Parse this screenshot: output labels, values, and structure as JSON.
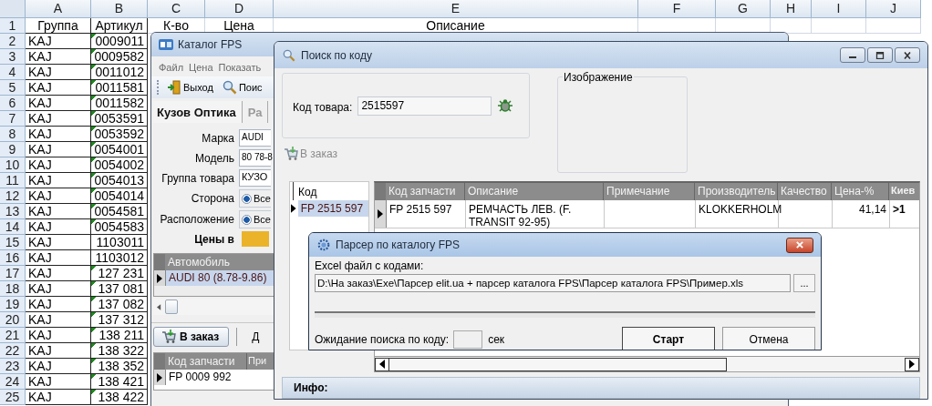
{
  "spreadsheet": {
    "columns": [
      "A",
      "B",
      "C",
      "D",
      "E",
      "F",
      "G",
      "H",
      "I",
      "J"
    ],
    "header": {
      "number": "1",
      "cells": [
        "Группа",
        "Артикул",
        "К-во",
        "Цена",
        "Описание"
      ]
    },
    "rows": [
      {
        "number": "2",
        "group": "KAJ",
        "article": "0009011",
        "flagged": true
      },
      {
        "number": "3",
        "group": "KAJ",
        "article": "0009582",
        "flagged": true
      },
      {
        "number": "4",
        "group": "KAJ",
        "article": "0011012",
        "flagged": true
      },
      {
        "number": "5",
        "group": "KAJ",
        "article": "0011581",
        "flagged": true
      },
      {
        "number": "6",
        "group": "KAJ",
        "article": "0011582",
        "flagged": true
      },
      {
        "number": "7",
        "group": "KAJ",
        "article": "0053591",
        "flagged": true
      },
      {
        "number": "8",
        "group": "KAJ",
        "article": "0053592",
        "flagged": true
      },
      {
        "number": "9",
        "group": "KAJ",
        "article": "0054001",
        "flagged": true
      },
      {
        "number": "10",
        "group": "KAJ",
        "article": "0054002",
        "flagged": true
      },
      {
        "number": "11",
        "group": "KAJ",
        "article": "0054013",
        "flagged": true
      },
      {
        "number": "12",
        "group": "KAJ",
        "article": "0054014",
        "flagged": true
      },
      {
        "number": "13",
        "group": "KAJ",
        "article": "0054581",
        "flagged": true
      },
      {
        "number": "14",
        "group": "KAJ",
        "article": "0054583",
        "flagged": true
      },
      {
        "number": "15",
        "group": "KAJ",
        "article": "1103011",
        "flagged": false
      },
      {
        "number": "16",
        "group": "KAJ",
        "article": "1103012",
        "flagged": false
      },
      {
        "number": "17",
        "group": "KAJ",
        "article": "127 231",
        "flagged": true
      },
      {
        "number": "18",
        "group": "KAJ",
        "article": "137 081",
        "flagged": true
      },
      {
        "number": "19",
        "group": "KAJ",
        "article": "137 082",
        "flagged": true
      },
      {
        "number": "20",
        "group": "KAJ",
        "article": "137 312",
        "flagged": true
      },
      {
        "number": "21",
        "group": "KAJ",
        "article": "138 211",
        "flagged": true
      },
      {
        "number": "22",
        "group": "KAJ",
        "article": "138 322",
        "flagged": true
      },
      {
        "number": "23",
        "group": "KAJ",
        "article": "138 352",
        "flagged": true
      },
      {
        "number": "24",
        "group": "KAJ",
        "article": "138 421",
        "flagged": true
      },
      {
        "number": "25",
        "group": "KAJ",
        "article": "138 422",
        "flagged": true
      }
    ]
  },
  "catalog_window": {
    "title": "Каталог FPS",
    "menu": [
      "Файл",
      "Цена",
      "Показать"
    ],
    "toolbar": [
      {
        "label": "Выход",
        "kind": "exit"
      },
      {
        "label": "Поис",
        "kind": "search"
      }
    ],
    "tabs": [
      {
        "label": "Кузов Оптика",
        "selected": true
      },
      {
        "label": "Ра",
        "selected": false
      }
    ],
    "fields": [
      {
        "kind": "combo",
        "label": "Марка",
        "value": "AUDI"
      },
      {
        "kind": "combo",
        "label": "Модель",
        "value": "80 78-8"
      },
      {
        "kind": "text",
        "label": "Группа товара",
        "value": "КУЗО"
      },
      {
        "kind": "radio",
        "label": "Сторона",
        "option": "Все",
        "checked": true
      },
      {
        "kind": "radio",
        "label": "Расположение",
        "option": "Все",
        "checked": true
      },
      {
        "kind": "swatch",
        "label": "Цены в"
      }
    ],
    "cars": {
      "header": "Автомобиль",
      "rows": [
        {
          "text": "AUDI  80 (8.78-9.86)",
          "selected": true
        }
      ]
    },
    "order_button": "В заказ",
    "cut_label": "Д",
    "parts": {
      "columns": [
        "Код запчасти",
        "При"
      ],
      "rows": [
        {
          "code": "FP 0009 992",
          "selected": true
        }
      ]
    }
  },
  "search_window": {
    "title": "Поиск по коду",
    "code_label": "Код товара:",
    "code_value": "2515597",
    "image_label": "Изображение",
    "order_button": {
      "label": "В заказ",
      "disabled": true
    },
    "codes": {
      "header": "Код",
      "rows": [
        {
          "text": "FP 2515 597",
          "selected": true
        }
      ]
    },
    "results": {
      "columns": [
        "Код запчасти",
        "Описание",
        "Примечание",
        "Производитель",
        "Качество",
        "Цена-%",
        "Киев"
      ],
      "rows": [
        {
          "selected": true,
          "code": "FP 2515 597",
          "description": "РЕМЧАСТЬ ЛЕВ. (F. TRANSIT 92-95)",
          "maker": "KLOKKERHOLM",
          "price": "41,14",
          "stock": ">1"
        }
      ]
    },
    "info_label": "Инфо:"
  },
  "parser_dialog": {
    "title": "Парсер по каталогу FPS",
    "file_label": "Excel файл с кодами:",
    "file_path": "D:\\На заказ\\Exe\\Парсер elit.ua + парсер каталога FPS\\Парсер каталога FPS\\Пример.xls",
    "browse_button": "...",
    "progress": {
      "level": 0
    },
    "wait_label": "Ожидание поиска по коду:",
    "wait_unit": "сек",
    "buttons": [
      {
        "label": "Старт",
        "default": true
      },
      {
        "label": "Отмена",
        "default": false
      }
    ]
  }
}
